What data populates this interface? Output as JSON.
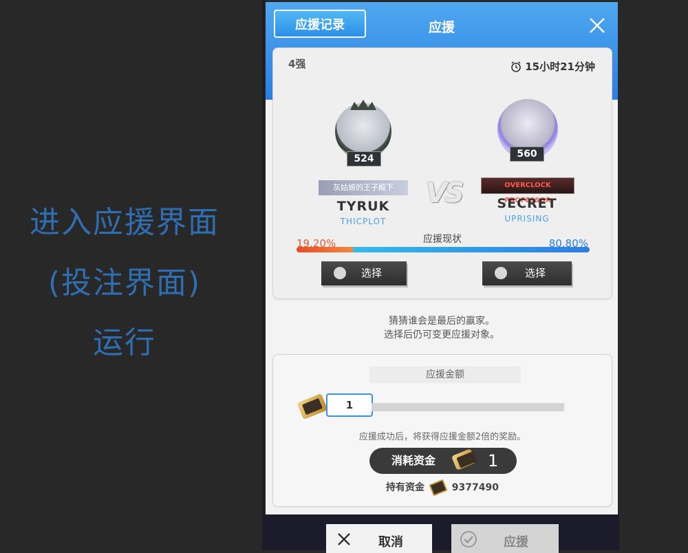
{
  "caption": {
    "line1": "进入应援界面",
    "line2": "(投注界面)",
    "line3": "运行"
  },
  "modal": {
    "record_button": "应援记录",
    "title": "应援"
  },
  "match": {
    "round": "4强",
    "timer": "15小时21分钟",
    "vs": "VS",
    "left": {
      "level": "524",
      "title": "灰姑娘的王子殿下",
      "name": "TYRUK",
      "team": "THICPLOT",
      "percent": "19.20%",
      "share": 0.192,
      "select_label": "选择"
    },
    "right": {
      "level": "560",
      "title": "OVERCLOCK PROFESSOR",
      "name": "SECRET",
      "team": "UPRISING",
      "percent": "80.80%",
      "share": 0.808,
      "select_label": "选择"
    },
    "status_label": "应援现状"
  },
  "hint": {
    "line1": "猜猜谁会是最后的赢家。",
    "line2": "选择后仍可变更应援对象。"
  },
  "amount": {
    "title": "应援金额",
    "value": "1",
    "reward_text": "应援成功后，将获得应援金额2倍的奖励。",
    "cost_label": "消耗资金",
    "cost_value": "1",
    "own_label": "持有资金",
    "own_value": "9377490"
  },
  "footer": {
    "cancel_label": "取消",
    "support_label": "应援"
  },
  "colors": {
    "accent": "#2a7fe2",
    "left_bar": "#e84a2a",
    "right_bar": "#2c7de6",
    "caption": "#2f6eb0"
  }
}
